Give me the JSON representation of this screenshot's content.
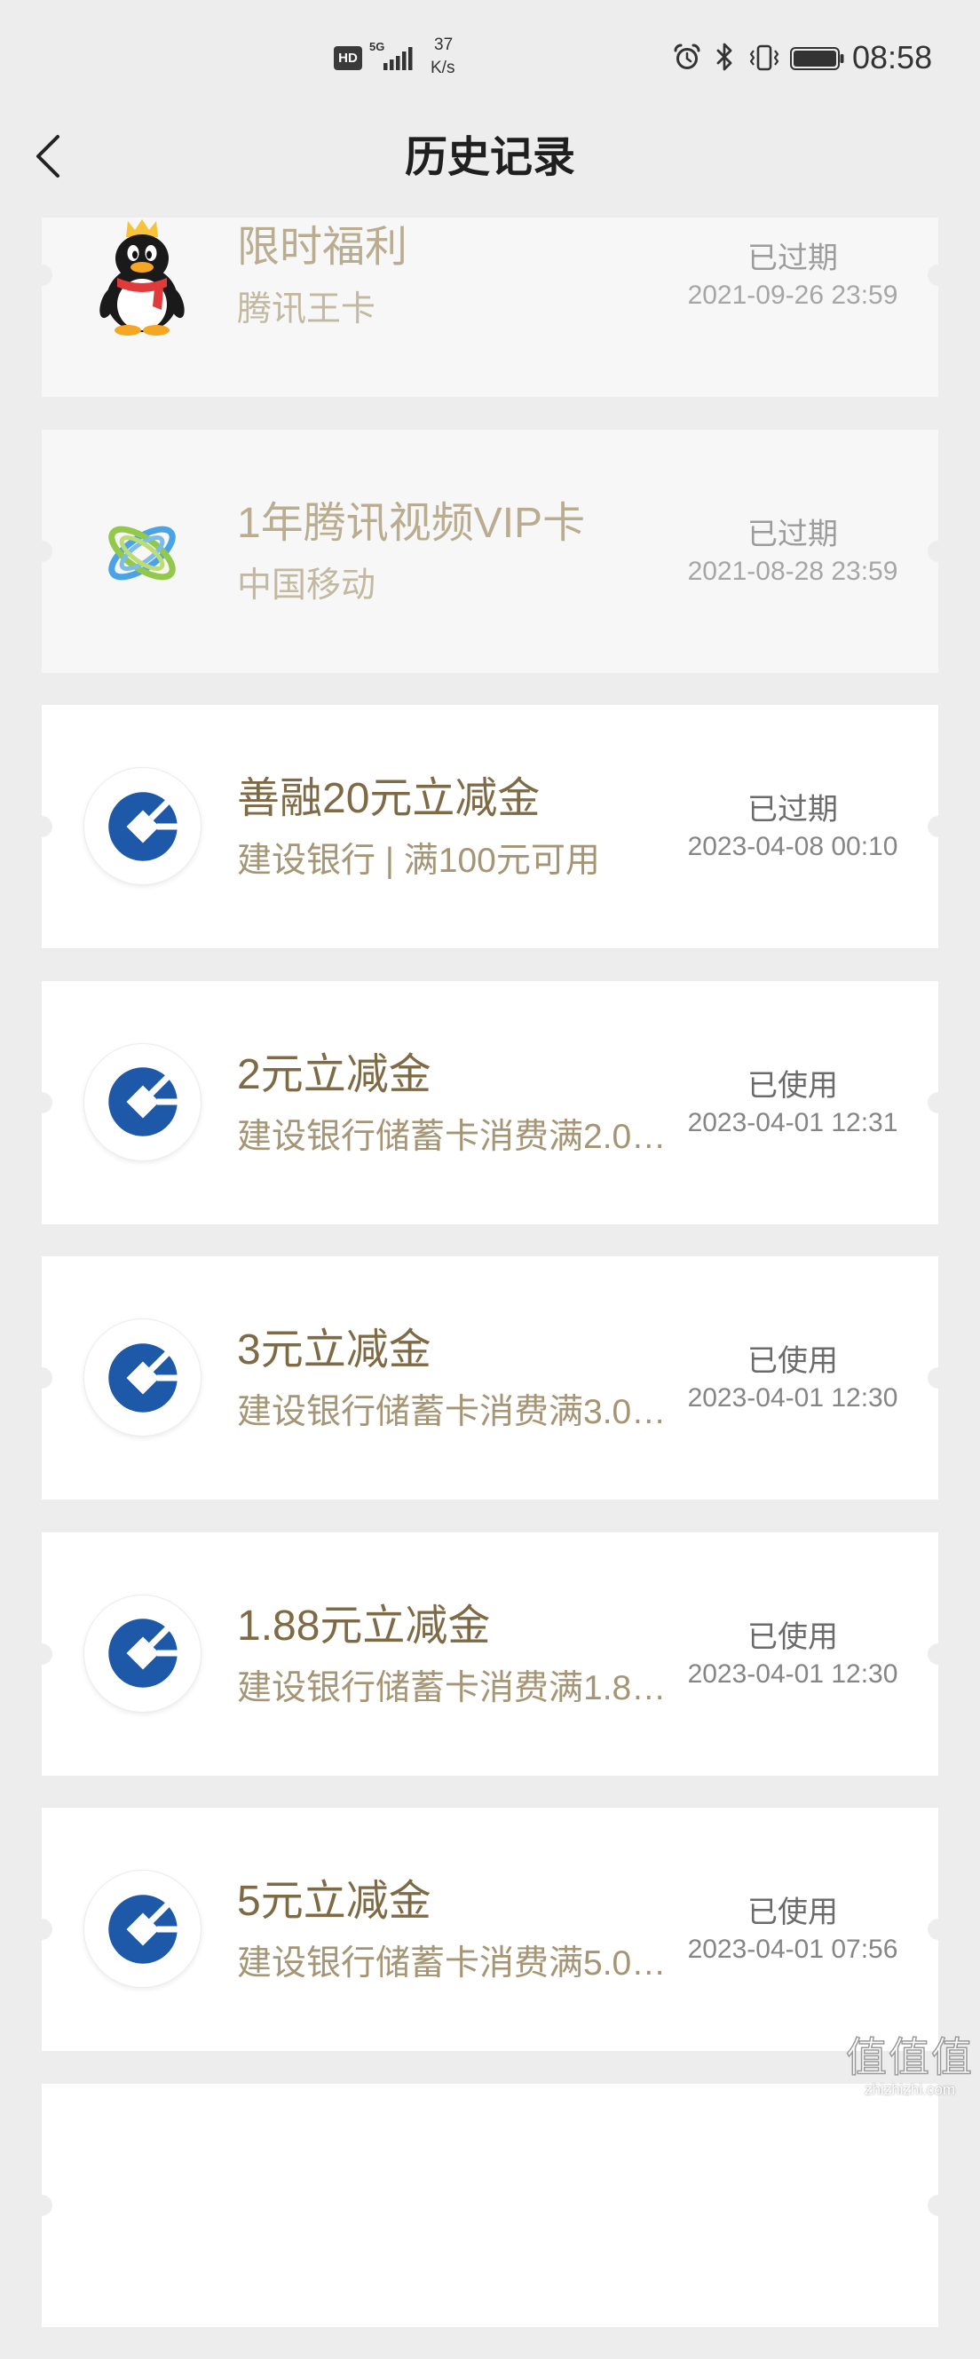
{
  "status_bar": {
    "hd_label": "HD",
    "network_label": "5G",
    "speed_value": "37",
    "speed_unit": "K/s",
    "time": "08:58",
    "battery_level": 1.0,
    "icons": {
      "hd": "hd-icon",
      "signal": "signal-icon",
      "alarm": "alarm-icon",
      "bluetooth": "bluetooth-icon",
      "vibrate": "vibrate-icon",
      "battery": "battery-icon"
    }
  },
  "header": {
    "title": "历史记录",
    "back_icon": "chevron-left-icon"
  },
  "records": [
    {
      "title": "限时福利",
      "subtitle": "腾讯王卡",
      "status": "已过期",
      "date": "2021-09-26 23:59",
      "logo": "qq-penguin-logo-icon",
      "dimmed": true
    },
    {
      "title": "1年腾讯视频VIP卡",
      "subtitle": "中国移动",
      "status": "已过期",
      "date": "2021-08-28 23:59",
      "logo": "china-mobile-logo-icon",
      "dimmed": true
    },
    {
      "title": "善融20元立减金",
      "subtitle": "建设银行 | 满100元可用",
      "status": "已过期",
      "date": "2023-04-08 00:10",
      "logo": "ccb-logo-icon",
      "dimmed": false
    },
    {
      "title": "2元立减金",
      "subtitle": "建设银行储蓄卡消费满2.0…",
      "status": "已使用",
      "date": "2023-04-01 12:31",
      "logo": "ccb-logo-icon",
      "dimmed": false
    },
    {
      "title": "3元立减金",
      "subtitle": "建设银行储蓄卡消费满3.0…",
      "status": "已使用",
      "date": "2023-04-01 12:30",
      "logo": "ccb-logo-icon",
      "dimmed": false
    },
    {
      "title": "1.88元立减金",
      "subtitle": "建设银行储蓄卡消费满1.8…",
      "status": "已使用",
      "date": "2023-04-01 12:30",
      "logo": "ccb-logo-icon",
      "dimmed": false
    },
    {
      "title": "5元立减金",
      "subtitle": "建设银行储蓄卡消费满5.0…",
      "status": "已使用",
      "date": "2023-04-01 07:56",
      "logo": "ccb-logo-icon",
      "dimmed": false
    }
  ],
  "watermark": {
    "mark": "值值值",
    "site": "zhizhizhi.com"
  },
  "colors": {
    "page_bg": "#ededed",
    "card_bg": "#ffffff",
    "card_bg_dimmed": "#f7f7f7",
    "title": "#7e6a44",
    "subtitle": "#a59574",
    "status": "#6b6b6b",
    "date": "#858585",
    "title_dimmed": "#b9ac8f",
    "subtitle_dimmed": "#c3b8a0",
    "status_dimmed": "#9c9c9c",
    "date_dimmed": "#a6a6a6",
    "ccb_blue": "#1d59a8"
  }
}
